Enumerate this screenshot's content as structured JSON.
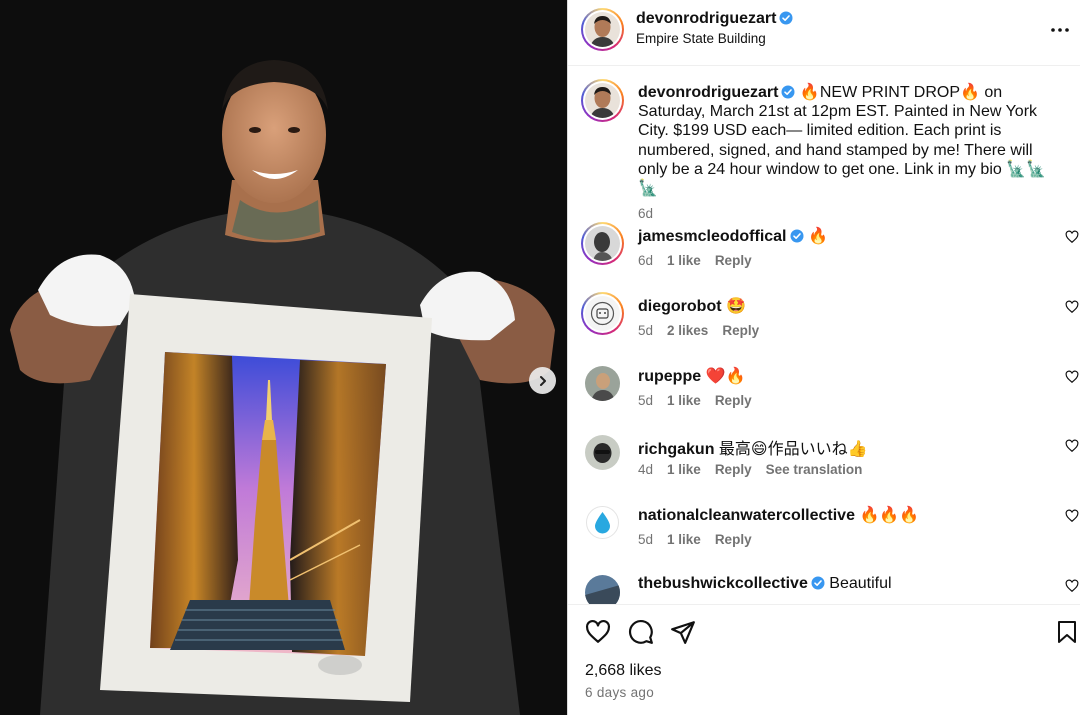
{
  "post": {
    "author": "devonrodriguezart",
    "location": "Empire State Building",
    "caption": "🔥NEW PRINT DROP🔥 on Saturday, March 21st at 12pm EST. Painted in New York City. $199 USD each— limited edition. Each print is numbered, signed, and hand stamped by me! There will only be a 24 hour window to get one. Link in my bio 🗽🗽🗽",
    "caption_age": "6d"
  },
  "comments": [
    {
      "user": "jamesmcleodoffical",
      "verified": true,
      "text": "🔥",
      "age": "6d",
      "likes": "1 like",
      "reply": "Reply",
      "extra": ""
    },
    {
      "user": "diegorobot",
      "verified": false,
      "text": "🤩",
      "age": "5d",
      "likes": "2 likes",
      "reply": "Reply",
      "extra": ""
    },
    {
      "user": "rupeppe",
      "verified": false,
      "text": "❤️🔥",
      "age": "5d",
      "likes": "1 like",
      "reply": "Reply",
      "extra": ""
    },
    {
      "user": "richgakun",
      "verified": false,
      "text": "最高😄作品いいね👍",
      "age": "4d",
      "likes": "1 like",
      "reply": "Reply",
      "extra": "See translation"
    },
    {
      "user": "nationalcleanwatercollective",
      "verified": false,
      "text": "🔥🔥🔥",
      "age": "5d",
      "likes": "1 like",
      "reply": "Reply",
      "extra": ""
    },
    {
      "user": "thebushwickcollective",
      "verified": true,
      "text": "Beautiful",
      "age": "",
      "likes": "",
      "reply": "",
      "extra": ""
    }
  ],
  "stats": {
    "likes": "2,668 likes",
    "time_ago": "6 days ago"
  },
  "icons": {
    "more": "more-options-icon",
    "like": "heart-icon",
    "comment": "comment-icon",
    "share": "share-icon",
    "save": "bookmark-icon",
    "next": "chevron-right-icon",
    "verified": "verified-badge-icon"
  },
  "colors": {
    "verified": "#3897f0",
    "secondary_text": "#737373",
    "story_ring": "#d62976"
  }
}
